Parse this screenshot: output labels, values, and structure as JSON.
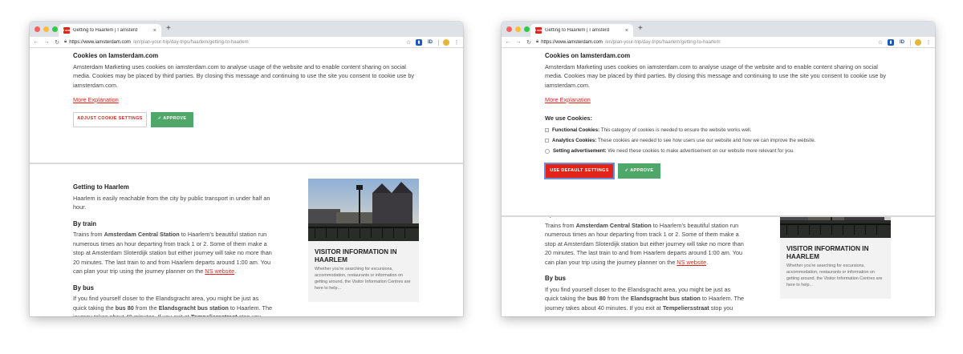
{
  "browser": {
    "tab_title": "Getting to Haarlem | I amsterd",
    "tab_close": "×",
    "new_tab": "+",
    "favicon_text": "I am",
    "url_host": "https://www.iamsterdam.com",
    "url_path": "/en/plan-your-trip/day-trips/haarlem/getting-to-haarlem",
    "ext_id": "ID",
    "icons": [
      "back-icon",
      "forward-icon",
      "reload-icon",
      "lock-icon",
      "star-icon",
      "menu-icon"
    ]
  },
  "cookie": {
    "title": "Cookies on Iamsterdam.com",
    "body": "Amsterdam Marketing uses cookies on iamsterdam.com to analyse usage of the website and to enable content sharing on social media. Cookies may be placed by third parties. By closing this message and continuing to use the site you consent to cookie use by iamsterdam.com.",
    "more_link": "More Explanation",
    "adjust_button": "ADJUST COOKIE SETTINGS",
    "approve_button": "✓ APPROVE",
    "default_button": "USE DEFAULT SETTINGS",
    "we_use": "We use Cookies:",
    "options": [
      {
        "label": "Functional Cookies:",
        "text": " This category of cookies is needed to ensure the website works well."
      },
      {
        "label": "Analytics Cookies:",
        "text": " These cookies are needed to see how users use our website and how we can improve the website."
      },
      {
        "label": "Setting advertisement:",
        "text": " We need these cookies to make advertisement on our website more relevant for you."
      }
    ]
  },
  "article": {
    "h_intro": "Getting to Haarlem",
    "p_intro": "Haarlem is easily reachable from the city by public transport in under half an hour.",
    "h_train": "By train",
    "train_1": "Trains from ",
    "train_b1": "Amsterdam Central Station",
    "train_2": " to Haarlem's beautiful station run numerous times an hour departing from track 1 or 2. Some of them make a stop at Amsterdam Sloterdijk station but either journey will take no more than 20 minutes. The last train to and from Haarlem departs around 1:00 am. You can plan your trip using the journey planner on the ",
    "train_link": "NS website",
    "train_3": ".",
    "h_bus": "By bus",
    "bus_1": "If you find yourself closer to the Elandsgracht area, you might be just as quick taking the ",
    "bus_b1": "bus 80",
    "bus_2": " from the ",
    "bus_b2": "Elandsgracht bus station",
    "bus_3": " to Haarlem. The journey takes about 40 minutes. If you exit at ",
    "bus_b3": "Tempeliersstraat",
    "bus_4": " stop you"
  },
  "card": {
    "title": "VISITOR INFORMATION IN HAARLEM",
    "text": "Whether you're searching for excursions, accommodation, restaurants or information on getting around, the Visitor Information Centres are here to help..."
  }
}
